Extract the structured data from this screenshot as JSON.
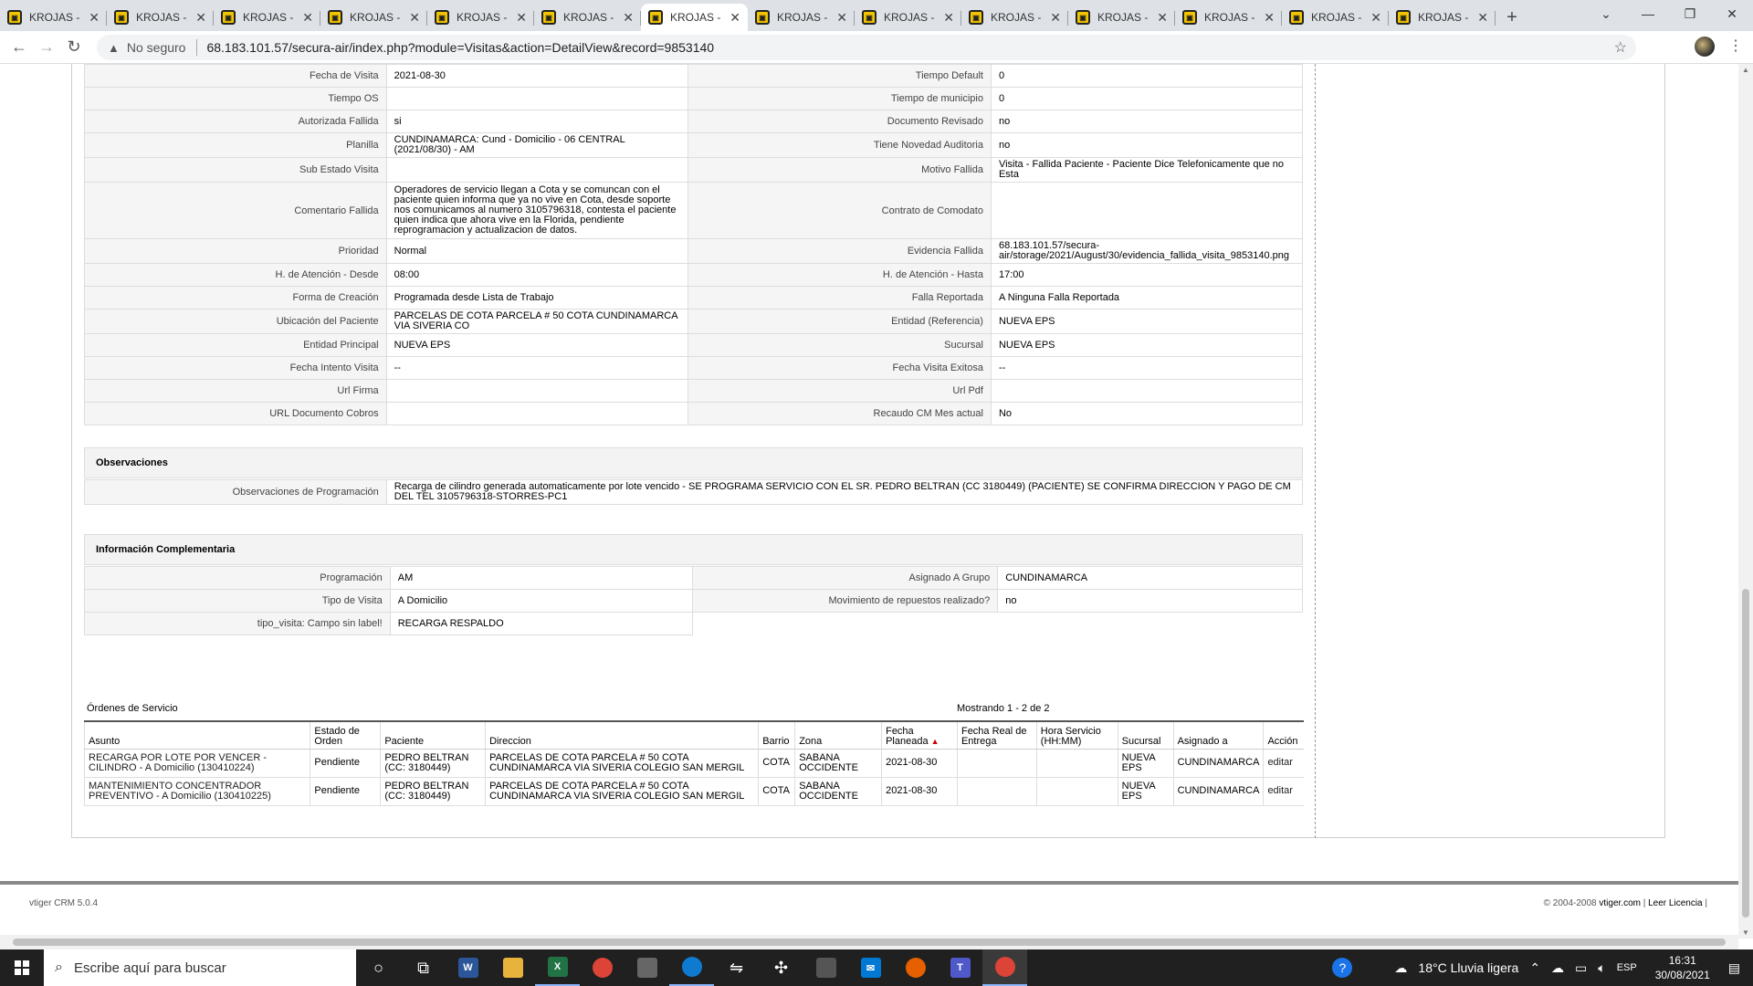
{
  "browser": {
    "tabs": [
      {
        "label": "KROJAS -",
        "active": false
      },
      {
        "label": "KROJAS -",
        "active": false
      },
      {
        "label": "KROJAS -",
        "active": false
      },
      {
        "label": "KROJAS -",
        "active": false
      },
      {
        "label": "KROJAS -",
        "active": false
      },
      {
        "label": "KROJAS -",
        "active": false
      },
      {
        "label": "KROJAS -",
        "active": true
      },
      {
        "label": "KROJAS -",
        "active": false
      },
      {
        "label": "KROJAS -",
        "active": false
      },
      {
        "label": "KROJAS -",
        "active": false
      },
      {
        "label": "KROJAS -",
        "active": false
      },
      {
        "label": "KROJAS -",
        "active": false
      },
      {
        "label": "KROJAS -",
        "active": false
      },
      {
        "label": "KROJAS -",
        "active": false
      }
    ],
    "security_label": "No seguro",
    "url": "68.183.101.57/secura-air/index.php?module=Visitas&action=DetailView&record=9853140"
  },
  "details": {
    "rows": [
      {
        "l1": "Fecha de Visita",
        "v1": "2021-08-30",
        "l2": "Tiempo Default",
        "v2": "0"
      },
      {
        "l1": "Tiempo OS",
        "v1": "",
        "l2": "Tiempo de municipio",
        "v2": "0"
      },
      {
        "l1": "Autorizada Fallida",
        "v1": "si",
        "l2": "Documento Revisado",
        "v2": "no"
      },
      {
        "l1": "Planilla",
        "v1": "CUNDINAMARCA: Cund - Domicilio - 06 CENTRAL (2021/08/30) - AM",
        "l2": "Tiene Novedad Auditoria",
        "v2": "no"
      },
      {
        "l1": "Sub Estado Visita",
        "v1": "",
        "l2": "Motivo Fallida",
        "v2": "Visita - Fallida Paciente - Paciente Dice Telefonicamente que no Esta"
      },
      {
        "l1": "Comentario Fallida",
        "v1": "Operadores de servicio llegan a Cota y se comuncan con el paciente quien informa que ya no vive en Cota, desde soporte nos comunicamos al numero 3105796318, contesta el paciente quien indica que ahora vive en la Florida, pendiente reprogramacion y actualizacion de datos.",
        "l2": "Contrato de Comodato",
        "v2": ""
      },
      {
        "l1": "Prioridad",
        "v1": "Normal",
        "l2": "Evidencia Fallida",
        "v2": "68.183.101.57/secura-air/storage/2021/August/30/evidencia_fallida_visita_9853140.png"
      },
      {
        "l1": "H. de Atención - Desde",
        "v1": "08:00",
        "l2": "H. de Atención - Hasta",
        "v2": "17:00"
      },
      {
        "l1": "Forma de Creación",
        "v1": "Programada desde Lista de Trabajo",
        "l2": "Falla Reportada",
        "v2": "A Ninguna Falla Reportada"
      },
      {
        "l1": "Ubicación del Paciente",
        "v1": "PARCELAS DE COTA PARCELA # 50 COTA CUNDINAMARCA VIA SIVERIA CO",
        "l2": "Entidad (Referencia)",
        "v2": "NUEVA EPS"
      },
      {
        "l1": "Entidad Principal",
        "v1": "NUEVA EPS",
        "l2": "Sucursal",
        "v2": "NUEVA EPS"
      },
      {
        "l1": "Fecha Intento Visita",
        "v1": "--",
        "l2": "Fecha Visita Exitosa",
        "v2": "--"
      },
      {
        "l1": "Url Firma",
        "v1": "",
        "l2": "Url Pdf",
        "v2": ""
      },
      {
        "l1": "URL Documento Cobros",
        "v1": "",
        "l2": "Recaudo CM Mes actual",
        "v2": "No"
      }
    ]
  },
  "observaciones": {
    "title": "Observaciones",
    "label": "Observaciones de Programación",
    "value": "Recarga de cilindro generada automaticamente por lote vencido - SE PROGRAMA SERVICIO CON EL SR. PEDRO BELTRAN (CC 3180449) (PACIENTE) SE CONFIRMA DIRECCION Y PAGO DE CM DEL TEL 3105796318-STORRES-PC1"
  },
  "info": {
    "title": "Información Complementaria",
    "rows": [
      {
        "l1": "Programación",
        "v1": "AM",
        "l2": "Asignado A Grupo",
        "v2": "CUNDINAMARCA"
      },
      {
        "l1": "Tipo de Visita",
        "v1": "A Domicilio",
        "l2": "Movimiento de repuestos realizado?",
        "v2": "no"
      },
      {
        "l1": "tipo_visita: Campo sin label!",
        "v1": "RECARGA RESPALDO"
      }
    ]
  },
  "ordenes": {
    "title": "Órdenes de Servicio",
    "count": "Mostrando 1 - 2 de 2",
    "headers": [
      "Asunto",
      "Estado de Orden",
      "Paciente",
      "Direccion",
      "Barrio",
      "Zona",
      "Fecha Planeada",
      "Fecha Real de Entrega",
      "Hora Servicio (HH:MM)",
      "Sucursal",
      "Asignado a",
      "Acción"
    ],
    "rows": [
      {
        "asunto": "RECARGA POR LOTE POR VENCER - CILINDRO - A Domicilio (130410224)",
        "estado": "Pendiente",
        "paciente": "PEDRO BELTRAN (CC: 3180449)",
        "direccion": "PARCELAS DE COTA PARCELA # 50 COTA CUNDINAMARCA VIA SIVERIA COLEGIO SAN MERGIL",
        "barrio": "COTA",
        "zona": "SABANA OCCIDENTE",
        "fecha": "2021-08-30",
        "real": "",
        "hora": "",
        "sucursal": "NUEVA EPS",
        "asignado": "CUNDINAMARCA",
        "accion": "editar"
      },
      {
        "asunto": "MANTENIMIENTO CONCENTRADOR PREVENTIVO - A Domicilio (130410225)",
        "estado": "Pendiente",
        "paciente": "PEDRO BELTRAN (CC: 3180449)",
        "direccion": "PARCELAS DE COTA PARCELA # 50 COTA CUNDINAMARCA VIA SIVERIA COLEGIO SAN MERGIL",
        "barrio": "COTA",
        "zona": "SABANA OCCIDENTE",
        "fecha": "2021-08-30",
        "real": "",
        "hora": "",
        "sucursal": "NUEVA EPS",
        "asignado": "CUNDINAMARCA",
        "accion": "editar"
      }
    ]
  },
  "footer": {
    "left": "vtiger CRM 5.0.4",
    "copyright": "© 2004-2008",
    "brand": "vtiger.com",
    "license": "Leer Licencia"
  },
  "taskbar": {
    "search_placeholder": "Escribe aquí para buscar",
    "weather": "18°C  Lluvia ligera",
    "lang": "ESP",
    "time": "16:31",
    "date": "30/08/2021"
  },
  "colors": {
    "accent": "#f2c500",
    "taskbar": "#202020",
    "chrome_tabbar": "#dee1e6"
  }
}
